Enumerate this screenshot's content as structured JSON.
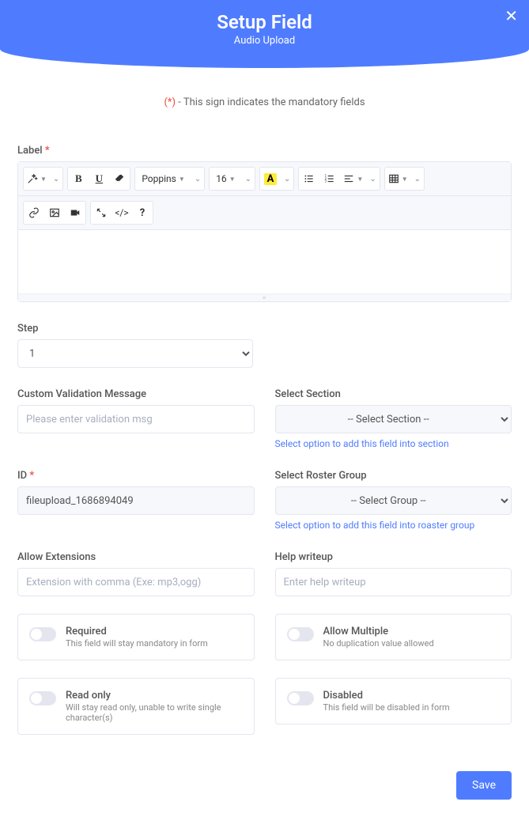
{
  "header": {
    "title": "Setup Field",
    "subtitle": "Audio Upload"
  },
  "note": {
    "marker": "(*)",
    "text": " - This sign indicates the mandatory fields"
  },
  "labels": {
    "label": "Label",
    "step": "Step",
    "custom_validation": "Custom Validation Message",
    "select_section": "Select Section",
    "id": "ID",
    "select_roster": "Select Roster Group",
    "allow_extensions": "Allow Extensions",
    "help_writeup": "Help writeup"
  },
  "editor_toolbar": {
    "font_family": "Poppins",
    "font_size": "16",
    "font_color_glyph": "A"
  },
  "step": {
    "value": "1"
  },
  "validation": {
    "placeholder": "Please enter validation msg"
  },
  "section": {
    "placeholder": "-- Select Section --",
    "helper": "Select option to add this field into section"
  },
  "id_field": {
    "value": "fileupload_1686894049"
  },
  "roster": {
    "placeholder": "-- Select Group --",
    "helper": "Select option to add this field into roaster group"
  },
  "extensions": {
    "placeholder": "Extension with comma (Exe: mp3,ogg)"
  },
  "help": {
    "placeholder": "Enter help writeup"
  },
  "toggles": {
    "required": {
      "title": "Required",
      "desc": "This field will stay mandatory in form"
    },
    "allow_multiple": {
      "title": "Allow Multiple",
      "desc": "No duplication value allowed"
    },
    "read_only": {
      "title": "Read only",
      "desc": "Will stay read only, unable to write single character(s)"
    },
    "disabled": {
      "title": "Disabled",
      "desc": "This field will be disabled in form"
    }
  },
  "footer": {
    "save": "Save"
  }
}
